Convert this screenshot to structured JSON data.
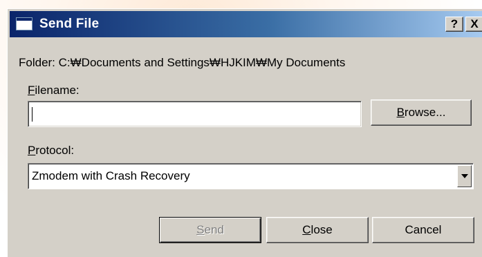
{
  "window": {
    "title": "Send File",
    "help_label": "?",
    "close_label": "X"
  },
  "folder": {
    "text": "Folder:  C:₩Documents and Settings₩HJKIM₩My Documents"
  },
  "filename": {
    "label_accel": "F",
    "label_rest": "ilename:",
    "value": ""
  },
  "browse": {
    "accel": "B",
    "rest": "rowse..."
  },
  "protocol": {
    "label_accel": "P",
    "label_rest": "rotocol:",
    "selected": "Zmodem with Crash Recovery"
  },
  "buttons": {
    "send_accel": "S",
    "send_rest": "end",
    "close_accel": "C",
    "close_rest": "lose",
    "cancel": "Cancel"
  },
  "colors": {
    "titlebar_start": "#0a246a",
    "titlebar_end": "#a6caf0",
    "face": "#d4d0c8"
  }
}
